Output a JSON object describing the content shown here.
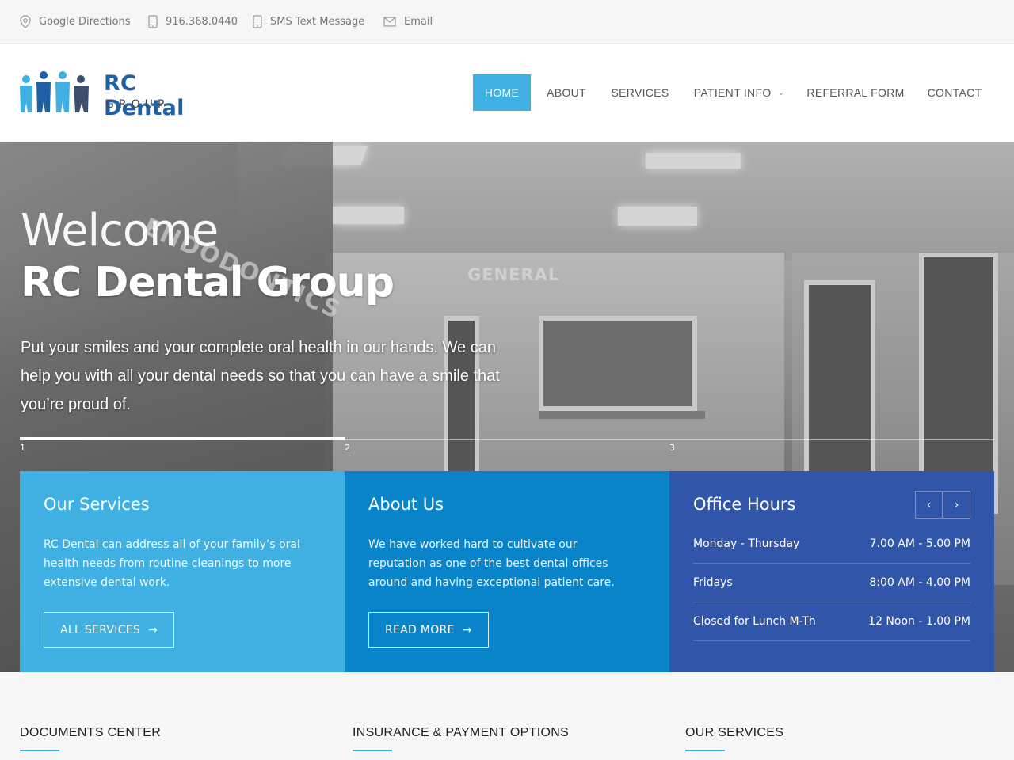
{
  "topbar": {
    "directions": "Google Directions",
    "phone": "916.368.0440",
    "sms": "SMS Text Message",
    "email": "Email"
  },
  "logo": {
    "name": "RC Dental",
    "sub": "GROUP"
  },
  "nav": {
    "home": "HOME",
    "about": "ABOUT",
    "services": "SERVICES",
    "patient_info": "PATIENT INFO",
    "referral": "REFERRAL FORM",
    "contact": "CONTACT"
  },
  "hero": {
    "welcome": "Welcome",
    "title": "RC Dental Group",
    "text": "Put your smiles and your complete oral health in our hands. We can help you with all your dental needs so that you can have a smile that you’re proud of.",
    "slides": [
      "1",
      "2",
      "3"
    ],
    "sign_general": "GENERAL",
    "sign_endodontics": "ENDODONTICS"
  },
  "services_box": {
    "title": "Our Services",
    "text": "RC Dental can address all of your family’s oral health needs from routine cleanings to more extensive dental work.",
    "button": "ALL SERVICES"
  },
  "about_box": {
    "title": "About Us",
    "text": "We have worked hard to cultivate our reputation as one of the best dental offices around and having exceptional patient care.",
    "button": "READ MORE"
  },
  "hours_box": {
    "title": "Office Hours",
    "rows": [
      {
        "day": "Monday - Thursday",
        "time": "7.00 AM - 5.00 PM"
      },
      {
        "day": "Fridays",
        "time": "8:00 AM - 4.00 PM"
      },
      {
        "day": "Closed for Lunch M-Th",
        "time": "12 Noon - 1.00 PM"
      }
    ]
  },
  "footer": {
    "documents": "DOCUMENTS CENTER",
    "insurance": "INSURANCE & PAYMENT OPTIONS",
    "services": "OUR SERVICES"
  },
  "colors": {
    "accent": "#3fb0e1",
    "about_blue": "#0a84c8",
    "hours_blue": "#3155a8",
    "logo_blue": "#1f5fa3"
  }
}
